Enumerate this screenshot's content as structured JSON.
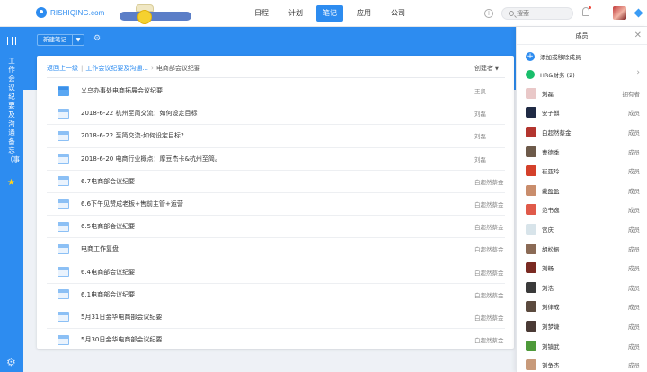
{
  "brand": {
    "name": "RISHIQING.com"
  },
  "nav": [
    {
      "label": "日程",
      "active": false
    },
    {
      "label": "计划",
      "active": false
    },
    {
      "label": "笔记",
      "active": true
    },
    {
      "label": "应用",
      "active": false
    },
    {
      "label": "公司",
      "active": false
    }
  ],
  "search": {
    "placeholder": "搜索"
  },
  "sidebar": {
    "title": "工作会议纪要及沟通备忘（事"
  },
  "toolbar": {
    "new_note": "新建笔记"
  },
  "breadcrumb": {
    "back": "返回上一级",
    "parent": "工作会议纪要及沟通...",
    "current": "电商部会议纪要"
  },
  "table": {
    "creator_header": "创建者",
    "rows": [
      {
        "title": "义乌办事处电商拓展会议纪要",
        "creator": "王凯",
        "icon": "folder-icon"
      },
      {
        "title": "2018-6-22 杭州至简交流：如何设定目标",
        "creator": "刘磊",
        "icon": "note-icon"
      },
      {
        "title": "2018-6-22 至简交流-如何设定目标?",
        "creator": "刘磊",
        "icon": "note-icon"
      },
      {
        "title": "2018-6-20 电商行业概点：摩豆杰卡&杭州至简。",
        "creator": "刘磊",
        "icon": "note-icon"
      },
      {
        "title": "6.7电商部会议纪要",
        "creator": "白超然蔡金",
        "icon": "note-icon"
      },
      {
        "title": "6.6下午见赞成老板+售前主管+运营",
        "creator": "白超然蔡金",
        "icon": "note-icon"
      },
      {
        "title": "6.5电商部会议纪要",
        "creator": "白超然蔡金",
        "icon": "note-icon"
      },
      {
        "title": "电商工作复盘",
        "creator": "白超然蔡金",
        "icon": "note-icon"
      },
      {
        "title": "6.4电商部会议纪要",
        "creator": "白超然蔡金",
        "icon": "note-icon"
      },
      {
        "title": "6.1电商部会议纪要",
        "creator": "白超然蔡金",
        "icon": "note-icon"
      },
      {
        "title": "5月31日金华电商部会议纪要",
        "creator": "白超然蔡金",
        "icon": "note-icon"
      },
      {
        "title": "5月30日金华电商部会议纪要",
        "creator": "白超然蔡金",
        "icon": "note-icon"
      }
    ]
  },
  "members_panel": {
    "title": "成员",
    "add_label": "添加或移除成员",
    "group": "HR&财务 (2)",
    "members": [
      {
        "name": "刘磊",
        "role": "拥有者",
        "color": "#e9c8c8"
      },
      {
        "name": "安子麒",
        "role": "成员",
        "color": "#1f2a44"
      },
      {
        "name": "白超然蔡金",
        "role": "成员",
        "color": "#b3352f"
      },
      {
        "name": "曹德季",
        "role": "成员",
        "color": "#6d5a4a"
      },
      {
        "name": "崔亚玲",
        "role": "成员",
        "color": "#d4402a"
      },
      {
        "name": "戴盈盈",
        "role": "成员",
        "color": "#c98d6c"
      },
      {
        "name": "范书逸",
        "role": "成员",
        "color": "#e05a4a"
      },
      {
        "name": "宫庆",
        "role": "成员",
        "color": "#d8e4ea"
      },
      {
        "name": "胡松振",
        "role": "成员",
        "color": "#8a6a55"
      },
      {
        "name": "刘畅",
        "role": "成员",
        "color": "#7a2a22"
      },
      {
        "name": "刘浩",
        "role": "成员",
        "color": "#3a3a3a"
      },
      {
        "name": "刘律成",
        "role": "成员",
        "color": "#5b4a3e"
      },
      {
        "name": "刘梦婕",
        "role": "成员",
        "color": "#4a3a35"
      },
      {
        "name": "刘镇武",
        "role": "成员",
        "color": "#4e9a3a"
      },
      {
        "name": "刘争杰",
        "role": "成员",
        "color": "#c89a7a"
      }
    ]
  }
}
